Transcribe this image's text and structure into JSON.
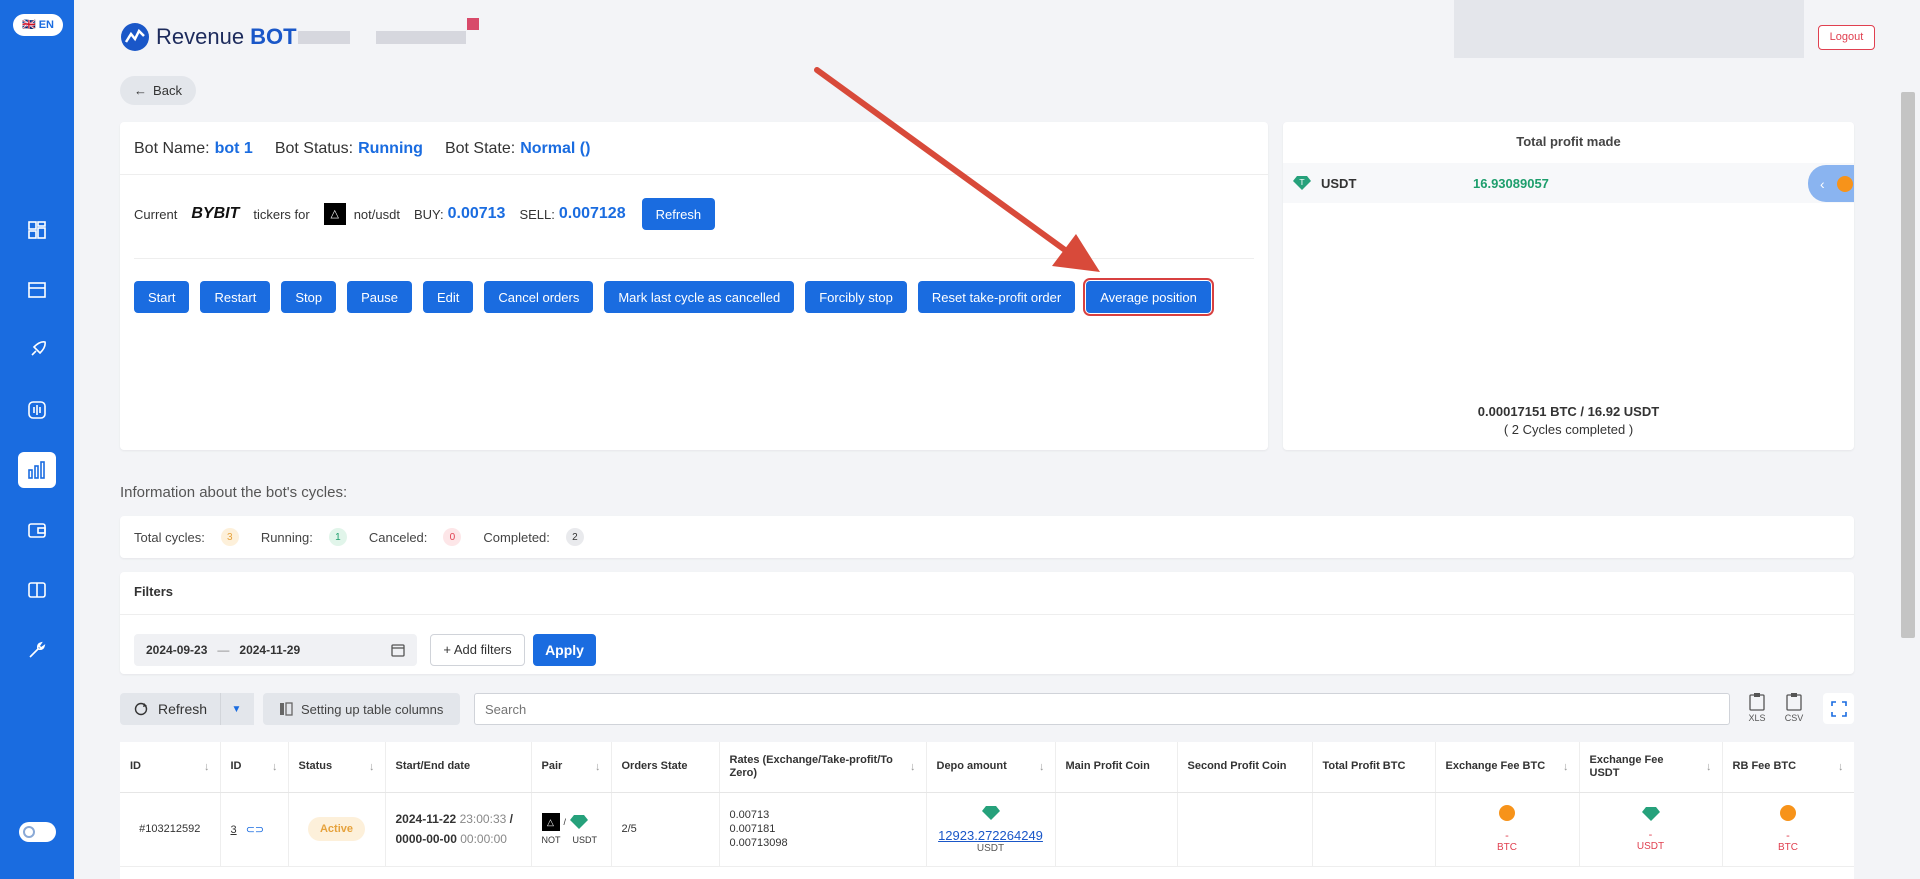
{
  "sidebar": {
    "lang": "🇬🇧 EN"
  },
  "header": {
    "logo_text": "Revenue",
    "logo_bold": "BOT",
    "logout_label": "Logout"
  },
  "back_label": "Back",
  "bot": {
    "name_label": "Bot Name:",
    "name": "bot 1",
    "status_label": "Bot Status:",
    "status": "Running",
    "state_label": "Bot State:",
    "state": "Normal ()"
  },
  "ticker": {
    "current_label": "Current",
    "exchange": "BYBIT",
    "tickers_for": "tickers for",
    "pair": "not/usdt",
    "buy_label": "BUY:",
    "buy": "0.00713",
    "sell_label": "SELL:",
    "sell": "0.007128",
    "refresh_label": "Refresh"
  },
  "actions": [
    "Start",
    "Restart",
    "Stop",
    "Pause",
    "Edit",
    "Cancel orders",
    "Mark last cycle as cancelled",
    "Forcibly stop",
    "Reset take-profit order",
    "Average position"
  ],
  "profit": {
    "title": "Total profit made",
    "coin": "USDT",
    "value": "16.93089057",
    "summary": "0.00017151 BTC / 16.92 USDT",
    "cycles": "( 2 Cycles completed )"
  },
  "cycles_heading": "Information about the bot's cycles:",
  "stats": [
    {
      "label": "Total cycles:",
      "value": "3",
      "bg": "#fdf0da",
      "fg": "#e6a23c"
    },
    {
      "label": "Running:",
      "value": "1",
      "bg": "#e1f5ea",
      "fg": "#1d9e6c"
    },
    {
      "label": "Canceled:",
      "value": "0",
      "bg": "#fde6e8",
      "fg": "#e04050"
    },
    {
      "label": "Completed:",
      "value": "2",
      "bg": "#e9eaed",
      "fg": "#333333"
    }
  ],
  "filters": {
    "title": "Filters",
    "date_from": "2024-09-23",
    "date_sep": "—",
    "date_to": "2024-11-29",
    "add_filters": "+ Add filters",
    "apply": "Apply"
  },
  "toolbar": {
    "refresh": "Refresh",
    "columns": "Setting up table columns",
    "search_placeholder": "Search",
    "xls": "XLS",
    "csv": "CSV"
  },
  "table": {
    "headers": [
      "ID",
      "ID",
      "Status",
      "Start/End date",
      "Pair",
      "Orders State",
      "Rates (Exchange/Take-profit/To Zero)",
      "Depo amount",
      "Main Profit Coin",
      "Second Profit Coin",
      "Total Profit BTC",
      "Exchange Fee BTC",
      "Exchange Fee USDT",
      "RB Fee BTC"
    ],
    "row": {
      "id": "#103212592",
      "cycle": "3",
      "status": "Active",
      "start_date": "2024-11-22",
      "start_time": "23:00:33",
      "sep": "/",
      "end_date": "0000-00-00",
      "end_time": "00:00:00",
      "pair_base": "NOT",
      "pair_slash": "/",
      "pair_quote": "USDT",
      "orders": "2/5",
      "rate1": "0.00713",
      "rate2": "0.007181",
      "rate3": "0.00713098",
      "depo": "12923.272264249",
      "depo_coin": "USDT",
      "fee_btc": "-",
      "fee_btc_coin": "BTC",
      "fee_usdt": "-",
      "fee_usdt_coin": "USDT",
      "rb_fee": "-",
      "rb_fee_coin": "BTC"
    }
  },
  "colors": {
    "accent": "#1a6ce0",
    "arrow": "#d84a3a",
    "profit": "#1d9e6c"
  }
}
